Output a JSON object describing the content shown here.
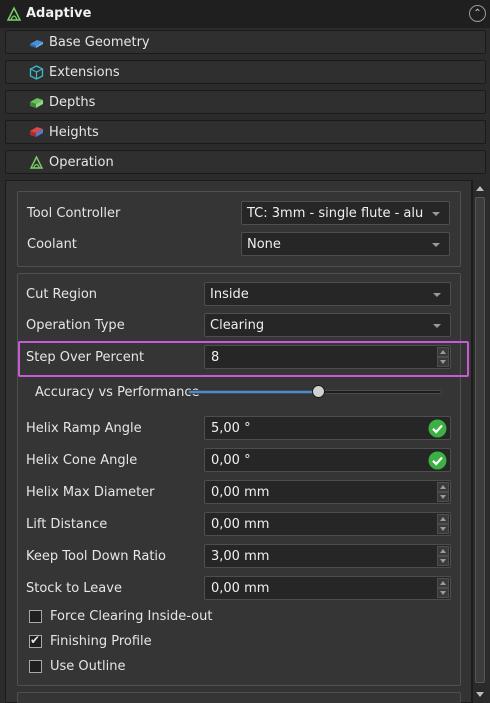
{
  "title": "Adaptive",
  "sections": [
    {
      "label": "Base Geometry",
      "icon": "base-geometry-icon"
    },
    {
      "label": "Extensions",
      "icon": "extensions-icon"
    },
    {
      "label": "Depths",
      "icon": "depths-icon"
    },
    {
      "label": "Heights",
      "icon": "heights-icon"
    },
    {
      "label": "Operation",
      "icon": "operation-icon"
    }
  ],
  "tool": {
    "controller_label": "Tool Controller",
    "controller_value": "TC: 3mm - single flute - alu",
    "coolant_label": "Coolant",
    "coolant_value": "None"
  },
  "params": {
    "cut_region_label": "Cut Region",
    "cut_region_value": "Inside",
    "operation_type_label": "Operation Type",
    "operation_type_value": "Clearing",
    "step_over_label": "Step Over Percent",
    "step_over_value": "8",
    "accuracy_label": "Accuracy vs Performance",
    "accuracy_level": 0.51,
    "helix_ramp_label": "Helix Ramp Angle",
    "helix_ramp_value": "5,00 °",
    "helix_cone_label": "Helix Cone Angle",
    "helix_cone_value": "0,00 °",
    "helix_max_label": "Helix Max Diameter",
    "helix_max_value": "0,00 mm",
    "lift_label": "Lift Distance",
    "lift_value": "0,00 mm",
    "keep_tool_label": "Keep Tool Down Ratio",
    "keep_tool_value": "3,00 mm",
    "stock_label": "Stock to Leave",
    "stock_value": "0,00 mm"
  },
  "options": {
    "force_clearing_label": "Force Clearing Inside-out",
    "force_clearing_checked": false,
    "finishing_label": "Finishing Profile",
    "finishing_checked": true,
    "use_outline_label": "Use Outline",
    "use_outline_checked": false
  },
  "colors": {
    "highlight": "#c75bd6",
    "slider_fill": "#3d8fe0",
    "ok_green": "#3cb043"
  }
}
